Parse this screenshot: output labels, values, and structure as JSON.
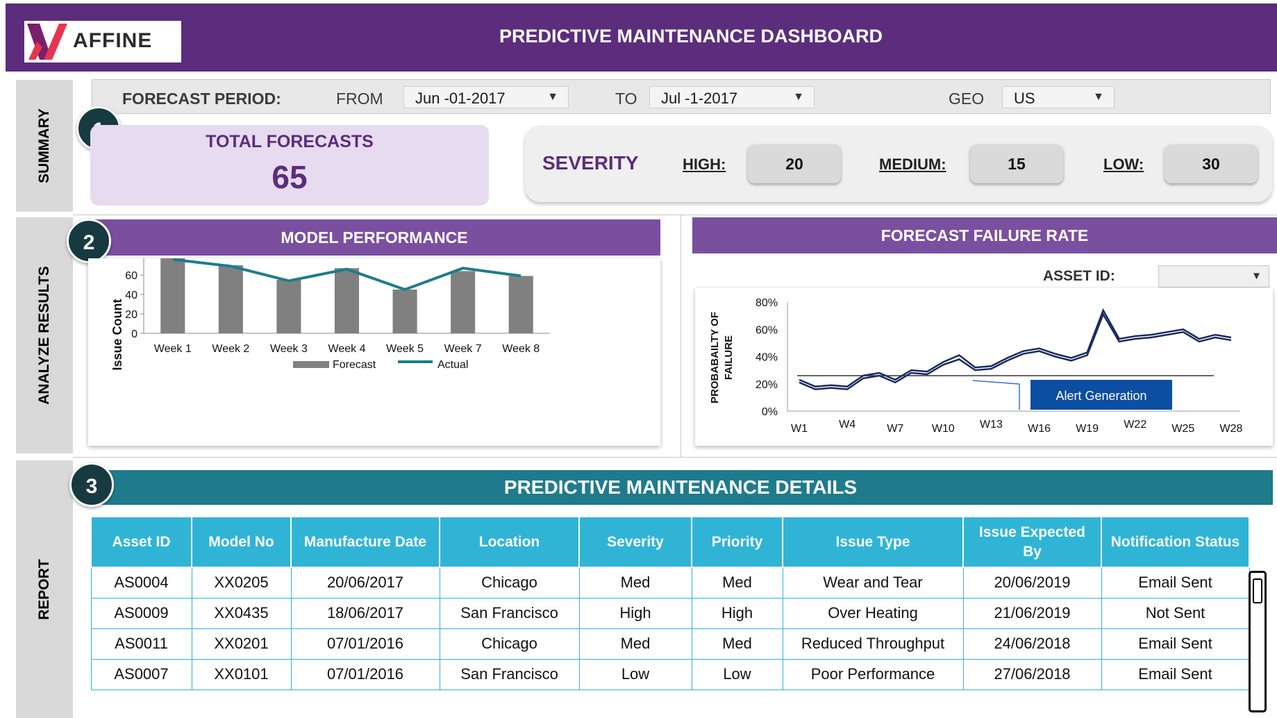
{
  "header": {
    "logo_text": "AFFINE",
    "title": "PREDICTIVE MAINTENANCE DASHBOARD"
  },
  "side_tabs": {
    "summary": "SUMMARY",
    "analyze": "ANALYZE RESULTS",
    "report": "REPORT"
  },
  "forecast_period": {
    "label": "FORECAST PERIOD:",
    "from_label": "FROM",
    "from_value": "Jun -01-2017",
    "to_label": "TO",
    "to_value": "Jul -1-2017",
    "geo_label": "GEO",
    "geo_value": "US"
  },
  "sections": {
    "one": "1",
    "two": "2",
    "three": "3"
  },
  "total_forecasts": {
    "label": "TOTAL FORECASTS",
    "value": "65"
  },
  "severity": {
    "title": "SEVERITY",
    "high_label": "HIGH:",
    "high_value": "20",
    "medium_label": "MEDIUM:",
    "medium_value": "15",
    "low_label": "LOW:",
    "low_value": "30"
  },
  "model_performance": {
    "title": "MODEL PERFORMANCE"
  },
  "forecast_failure": {
    "title": "FORECAST FAILURE RATE",
    "asset_label": "ASSET ID:",
    "asset_value": "",
    "alert_label": "Alert Generation"
  },
  "report": {
    "title": "PREDICTIVE MAINTENANCE DETAILS",
    "columns": [
      "Asset ID",
      "Model No",
      "Manufacture Date",
      "Location",
      "Severity",
      "Priority",
      "Issue Type",
      "Issue Expected By",
      "Notification Status"
    ],
    "rows": [
      [
        "AS0004",
        "XX0205",
        "20/06/2017",
        "Chicago",
        "Med",
        "Med",
        "Wear and Tear",
        "20/06/2019",
        "Email Sent"
      ],
      [
        "AS0009",
        "XX0435",
        "18/06/2017",
        "San Francisco",
        "High",
        "High",
        "Over Heating",
        "21/06/2019",
        "Not Sent"
      ],
      [
        "AS0011",
        "XX0201",
        "07/01/2016",
        "Chicago",
        "Med",
        "Med",
        "Reduced Throughput",
        "24/06/2018",
        "Email Sent"
      ],
      [
        "AS0007",
        "XX0101",
        "07/01/2016",
        "San Francisco",
        "Low",
        "Low",
        "Poor Performance",
        "27/06/2018",
        "Email Sent"
      ]
    ]
  },
  "colors": {
    "header": "#5b2d7c",
    "section_purple": "#7b4fa0",
    "report_teal": "#1f7b8c",
    "table_header": "#30b4d6",
    "alert": "#0b4ea2"
  },
  "chart_data": [
    {
      "type": "bar",
      "title": "",
      "ylabel": "Issue Count",
      "xlabel": "",
      "ylim": [
        0,
        100
      ],
      "yticks": [
        0,
        20,
        40,
        60,
        80,
        100
      ],
      "categories": [
        "Week 1",
        "Week 2",
        "Week 3",
        "Week 4",
        "Week 5",
        "Week 7",
        "Week 8"
      ],
      "series": [
        {
          "name": "Forecast",
          "kind": "bar",
          "color": "#808080",
          "values": [
            78,
            70,
            55,
            67,
            45,
            64,
            59
          ]
        },
        {
          "name": "Actual",
          "kind": "line",
          "color": "#1f7b8c",
          "values": [
            76,
            69,
            54,
            66,
            45,
            67,
            59
          ]
        }
      ],
      "legend": "bottom"
    },
    {
      "type": "line",
      "title": "",
      "ylabel": "PROBABAILTY OF FAILURE",
      "ylim": [
        0,
        0.8
      ],
      "yticks": [
        "0%",
        "20%",
        "40%",
        "60%",
        "80%"
      ],
      "xticks": [
        "W1",
        "W4",
        "W7",
        "W10",
        "W13",
        "W16",
        "W19",
        "W22",
        "W25",
        "W28"
      ],
      "threshold": 0.26,
      "x": [
        1,
        2,
        3,
        4,
        5,
        6,
        7,
        8,
        9,
        10,
        11,
        12,
        13,
        14,
        15,
        16,
        17,
        18,
        19,
        20,
        21,
        22,
        23,
        24,
        25,
        26,
        27,
        28
      ],
      "series": [
        {
          "name": "",
          "color": "#1a2a5e",
          "values": [
            0.21,
            0.16,
            0.17,
            0.16,
            0.24,
            0.26,
            0.21,
            0.28,
            0.27,
            0.34,
            0.38,
            0.3,
            0.31,
            0.37,
            0.42,
            0.44,
            0.4,
            0.37,
            0.41,
            0.71,
            0.51,
            0.53,
            0.54,
            0.56,
            0.58,
            0.51,
            0.54,
            0.52
          ]
        },
        {
          "name": "",
          "color": "#1a2a5e",
          "values": [
            0.23,
            0.18,
            0.19,
            0.18,
            0.26,
            0.28,
            0.23,
            0.3,
            0.29,
            0.36,
            0.41,
            0.32,
            0.33,
            0.39,
            0.44,
            0.46,
            0.42,
            0.39,
            0.43,
            0.74,
            0.53,
            0.55,
            0.56,
            0.58,
            0.6,
            0.53,
            0.56,
            0.54
          ]
        }
      ]
    }
  ]
}
